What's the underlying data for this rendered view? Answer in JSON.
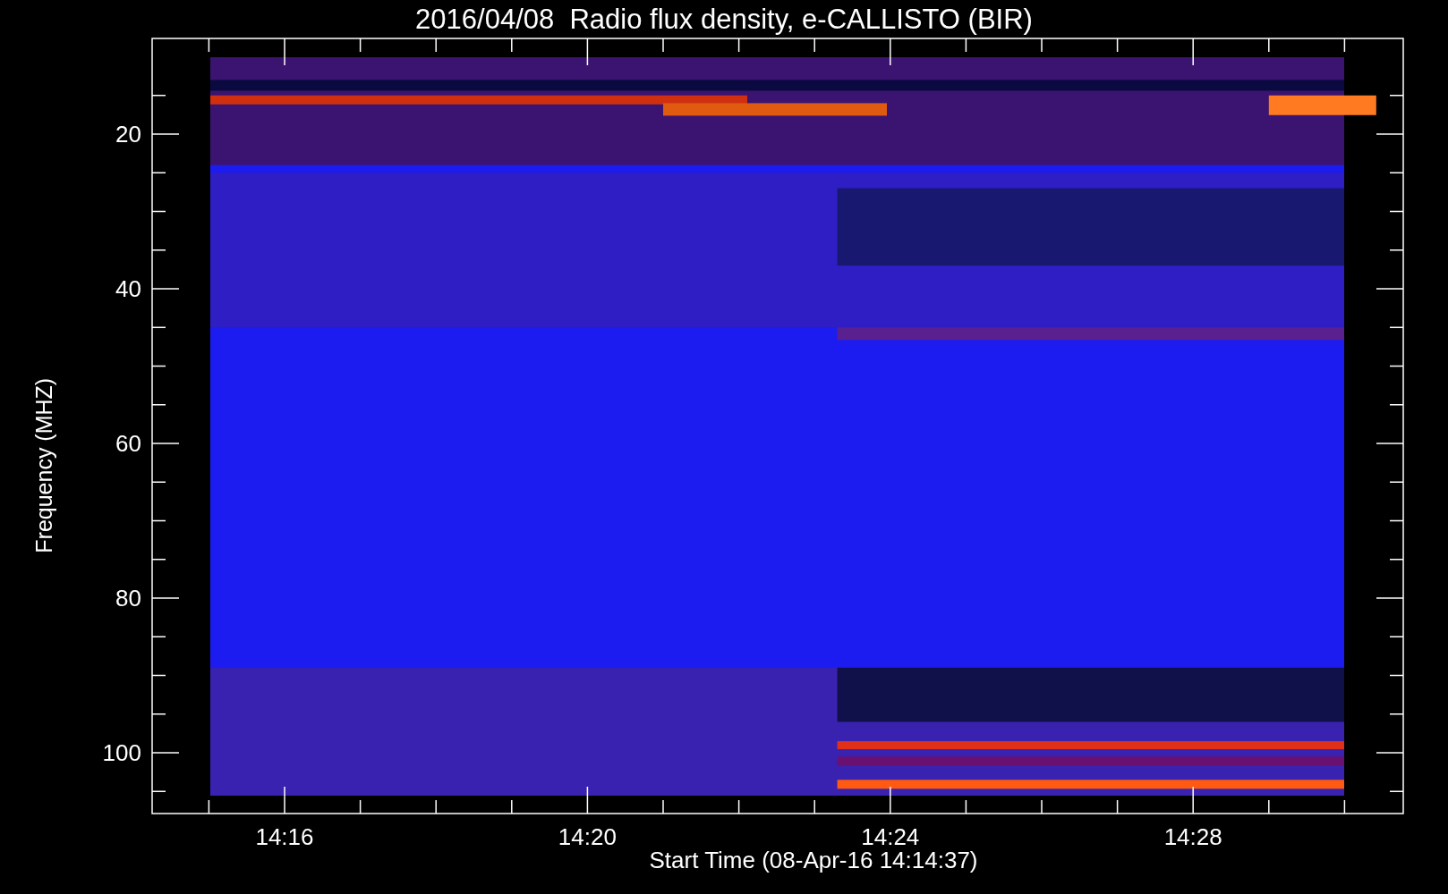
{
  "title": "2016/04/08  Radio flux density, e-CALLISTO (BIR)",
  "ylabel": "Frequency (MHZ)",
  "xlabel": "Start Time (08-Apr-16 14:14:37)",
  "yticks": [
    "20",
    "40",
    "60",
    "80",
    "100"
  ],
  "xticks": [
    "14:16",
    "14:20",
    "14:24",
    "14:28"
  ]
}
